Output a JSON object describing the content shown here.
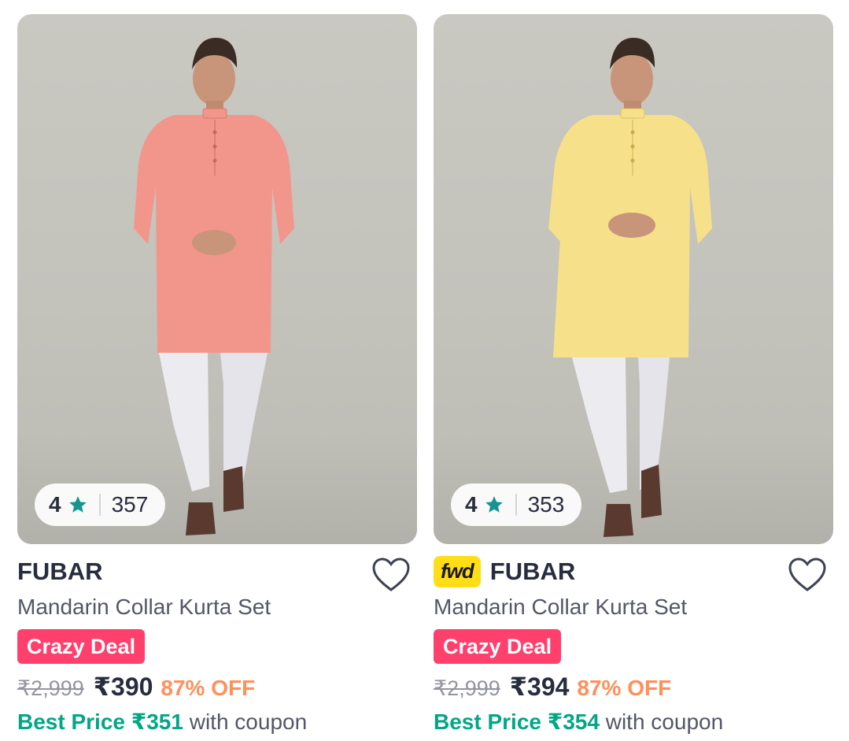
{
  "colors": {
    "accent_pink": "#ff3f6c",
    "best_price_green": "#03a685",
    "discount_orange": "#ff905a",
    "star_green": "#14958f",
    "fwd_yellow": "#ffde17"
  },
  "products": [
    {
      "rating": "4",
      "rating_count": "357",
      "fwd_badge": "",
      "brand": "FUBAR",
      "title": "Mandarin Collar Kurta Set",
      "deal_badge": "Crazy Deal",
      "mrp": "₹2,999",
      "price": "₹390",
      "discount": "87% OFF",
      "best_price_label": "Best Price ₹351",
      "best_price_suffix": "with coupon",
      "kurta_color": "#f2968c",
      "icons": [
        "star-icon",
        "heart-outline-icon"
      ]
    },
    {
      "rating": "4",
      "rating_count": "353",
      "fwd_badge": "fwd",
      "brand": "FUBAR",
      "title": "Mandarin Collar Kurta Set",
      "deal_badge": "Crazy Deal",
      "mrp": "₹2,999",
      "price": "₹394",
      "discount": "87% OFF",
      "best_price_label": "Best Price ₹354",
      "best_price_suffix": "with coupon",
      "kurta_color": "#f6e08a",
      "icons": [
        "star-icon",
        "heart-outline-icon"
      ]
    }
  ]
}
